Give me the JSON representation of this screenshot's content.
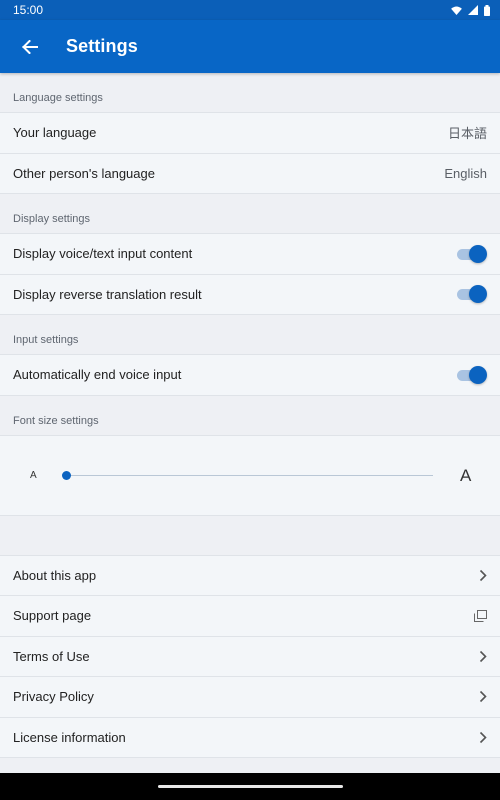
{
  "status_bar": {
    "time": "15:00"
  },
  "app_bar": {
    "title": "Settings"
  },
  "sections": {
    "language": {
      "header": "Language settings",
      "your_language": {
        "label": "Your language",
        "value": "日本語"
      },
      "other_language": {
        "label": "Other person's language",
        "value": "English"
      }
    },
    "display": {
      "header": "Display settings",
      "voice_text": {
        "label": "Display voice/text input content",
        "on": true
      },
      "reverse_translation": {
        "label": "Display reverse translation result",
        "on": true
      }
    },
    "input": {
      "header": "Input settings",
      "auto_end": {
        "label": "Automatically end voice input",
        "on": true
      }
    },
    "font_size": {
      "header": "Font size settings",
      "small_label": "A",
      "large_label": "A",
      "level": 0
    }
  },
  "links": [
    {
      "label": "About this app",
      "icon": "chevron-right-icon"
    },
    {
      "label": "Support page",
      "icon": "external-link-icon"
    },
    {
      "label": "Terms of Use",
      "icon": "chevron-right-icon"
    },
    {
      "label": "Privacy Policy",
      "icon": "chevron-right-icon"
    },
    {
      "label": "License information",
      "icon": "chevron-right-icon"
    }
  ],
  "colors": {
    "primary": "#0866c6",
    "accent": "#0b63c0",
    "background": "#eef0f4"
  }
}
